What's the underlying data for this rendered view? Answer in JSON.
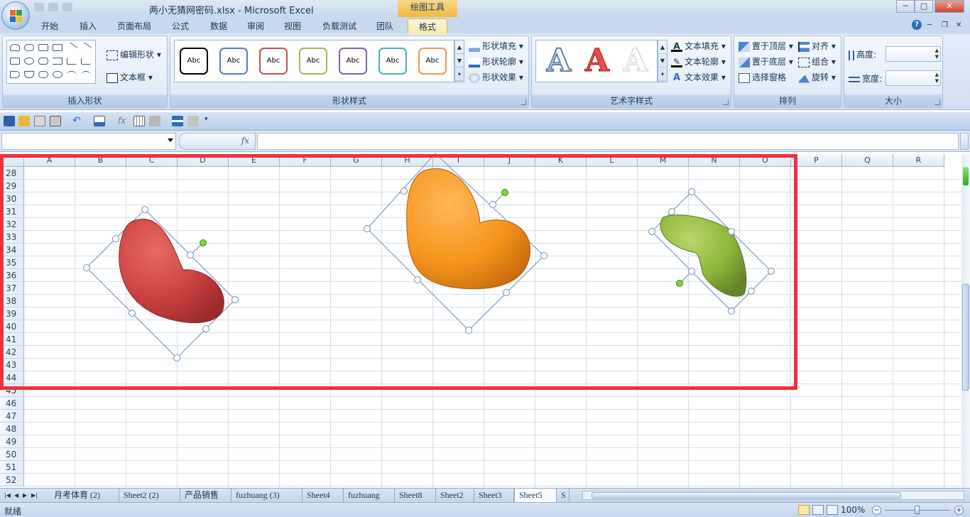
{
  "window": {
    "title": "两小无猜网密码.xlsx - Microsoft Excel",
    "context_tab_group": "绘图工具",
    "min_label": "─",
    "max_label": "□",
    "close_label": "✕"
  },
  "tabs": [
    "开始",
    "插入",
    "页面布局",
    "公式",
    "数据",
    "审阅",
    "视图",
    "负载测试",
    "团队",
    "格式"
  ],
  "active_tab": "格式",
  "help_label": "?",
  "ribbon": {
    "insert_shapes": {
      "label": "插入形状",
      "edit_shape": "编辑形状",
      "text_box": "文本框"
    },
    "shape_styles": {
      "label": "形状样式",
      "sample": "Abc",
      "swatch_colors": [
        "#000000",
        "#4f81bd",
        "#c0504d",
        "#9bbb59",
        "#8064a2",
        "#4bacc6",
        "#f79646"
      ],
      "fill": "形状填充",
      "outline": "形状轮廓",
      "effects": "形状效果"
    },
    "wordart": {
      "label": "艺术字样式",
      "letter": "A",
      "text_fill": "文本填充",
      "text_outline": "文本轮廓",
      "text_effects": "文本效果"
    },
    "arrange": {
      "label": "排列",
      "bring_front": "置于顶层",
      "send_back": "置于底层",
      "selection_pane": "选择窗格",
      "align": "对齐",
      "group": "组合",
      "rotate": "旋转"
    },
    "size": {
      "label": "大小",
      "height": "高度:",
      "width": "宽度:"
    }
  },
  "formula_bar": {
    "name_box": "",
    "fx": "fx",
    "formula": ""
  },
  "columns": [
    "A",
    "B",
    "C",
    "D",
    "E",
    "F",
    "G",
    "H",
    "I",
    "J",
    "K",
    "L",
    "M",
    "N",
    "O",
    "P",
    "Q",
    "R"
  ],
  "rows": [
    "28",
    "29",
    "30",
    "31",
    "32",
    "33",
    "34",
    "35",
    "36",
    "37",
    "38",
    "39",
    "40",
    "41",
    "42",
    "43",
    "44",
    "45",
    "46",
    "47",
    "48",
    "49",
    "50",
    "51",
    "52"
  ],
  "shapes": [
    {
      "name": "red-heart",
      "color": "#c8413e"
    },
    {
      "name": "orange-heart",
      "color": "#f7941d"
    },
    {
      "name": "green-heart",
      "color": "#8db43a"
    }
  ],
  "sheet_tabs": [
    "月考体育 (2)",
    "Sheet2 (2)",
    "产品销售",
    "fuzhuang (3)",
    "Sheet4",
    "fuzhuang",
    "Sheet8",
    "Sheet2",
    "Sheet3",
    "Sheet5",
    "S"
  ],
  "active_sheet": "Sheet5",
  "status": {
    "ready": "就绪",
    "zoom": "100%",
    "zoom_out": "−",
    "zoom_in": "+"
  },
  "highlight_color": "#f12f3d"
}
